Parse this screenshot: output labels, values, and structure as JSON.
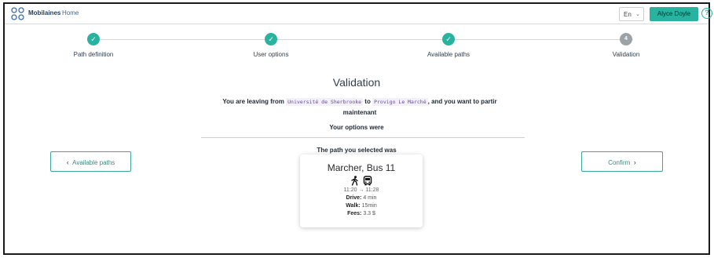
{
  "header": {
    "brand": "Mobilaines",
    "home": "Home",
    "language": "En",
    "user_name": "Alyce Doyle",
    "help_symbol": "?",
    "accent_color": "#27b3a0"
  },
  "stepper": {
    "steps": [
      {
        "label": "Path definition",
        "done": true
      },
      {
        "label": "User options",
        "done": true
      },
      {
        "label": "Available paths",
        "done": true
      },
      {
        "label": "Validation",
        "done": false,
        "number": "4"
      }
    ]
  },
  "main": {
    "title": "Validation",
    "leaving_prefix": "You are leaving from",
    "origin": "Université de Sherbrooke",
    "to": "to",
    "destination": "Provigo Le Marché",
    "leaving_suffix": ", and you want to partir",
    "leaving_when": "maintenant",
    "options_title": "Your options were",
    "path_title": "The path you selected was"
  },
  "nav": {
    "back_label": "Available paths",
    "confirm_label": "Confirm"
  },
  "card": {
    "route_name": "Marcher, Bus 11",
    "time_range": "11:20 → 11:28",
    "drive_label": "Drive:",
    "drive_value": "4 min",
    "walk_label": "Walk:",
    "walk_value": "15min",
    "fees_label": "Fees:",
    "fees_value": "3.3 $",
    "icons": [
      "walk-icon",
      "bus-icon"
    ]
  }
}
